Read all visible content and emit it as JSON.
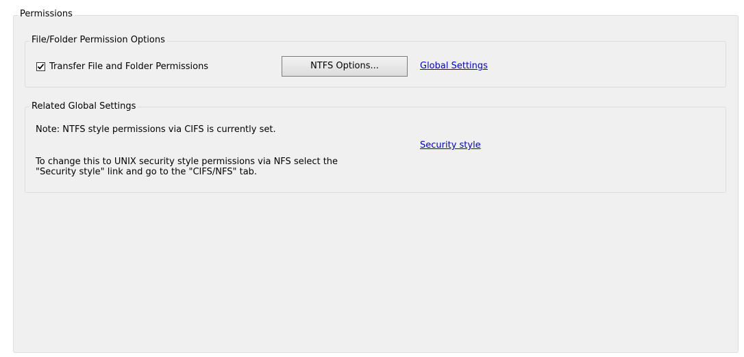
{
  "permissions_group": {
    "title": "Permissions"
  },
  "file_folder_options": {
    "title": "File/Folder Permission Options",
    "transfer_checkbox": {
      "label": "Transfer File and Folder Permissions",
      "checked": true
    },
    "ntfs_button_label": "NTFS Options...",
    "global_settings_link": "Global Settings"
  },
  "related_global_settings": {
    "title": "Related Global Settings",
    "note": "Note: NTFS style permissions via CIFS is currently set.",
    "change_line1": "To change this to UNIX security style permissions via NFS select the",
    "change_line2": "\"Security style\" link and go to the \"CIFS/NFS\" tab.",
    "security_style_link": "Security style"
  },
  "icons": [
    "checkmark-icon"
  ],
  "colors": {
    "link": "#0000cc",
    "panel_background": "#f0f0f0",
    "group_border": "#dcdcdc"
  }
}
